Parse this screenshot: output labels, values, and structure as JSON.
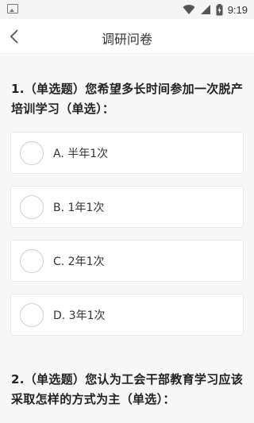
{
  "status_bar": {
    "time": "9:19",
    "icons": [
      "gallery-icon",
      "wifi-icon",
      "signal-icon",
      "battery-icon"
    ]
  },
  "header": {
    "title": "调研问卷",
    "back_icon": "chevron-left-icon"
  },
  "questions": [
    {
      "text": "1.（单选题）您希望多长时间参加一次脱产培训学习（单选）：",
      "options": [
        {
          "label": "A. 半年1次"
        },
        {
          "label": "B. 1年1次"
        },
        {
          "label": "C. 2年1次"
        },
        {
          "label": "D. 3年1次"
        }
      ]
    },
    {
      "text": "2.（单选题）您认为工会干部教育学习应该采取怎样的方式为主（单选）："
    }
  ],
  "colors": {
    "background": "#f7f7f7",
    "card": "#ffffff",
    "text": "#222222"
  }
}
